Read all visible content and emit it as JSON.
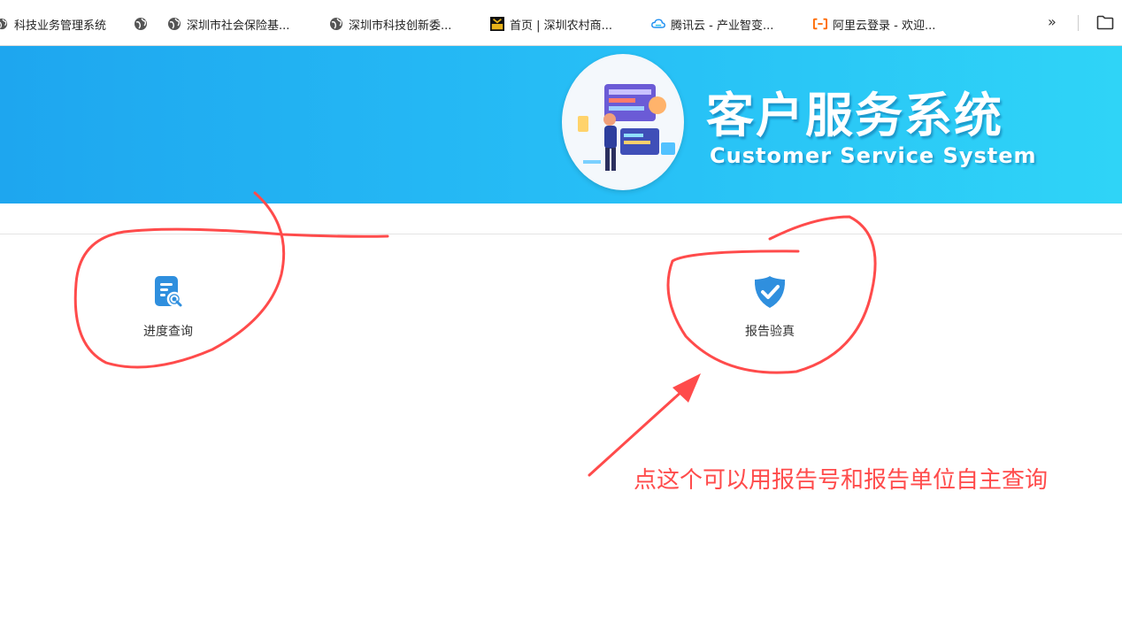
{
  "bookmarks": {
    "items": [
      {
        "label": "科技业务管理系统",
        "icon": "globe-icon"
      },
      {
        "label": "",
        "icon": "globe-icon"
      },
      {
        "label": "深圳市社会保险基...",
        "icon": "globe-icon"
      },
      {
        "label": "深圳市科技创新委...",
        "icon": "globe-icon"
      },
      {
        "label": "首页 | 深圳农村商...",
        "icon": "bank-logo-icon"
      },
      {
        "label": "腾讯云 - 产业智变...",
        "icon": "tencent-cloud-icon"
      },
      {
        "label": "阿里云登录 - 欢迎...",
        "icon": "aliyun-icon"
      }
    ],
    "overflow_label": "»",
    "folder_icon": "folder-icon"
  },
  "banner": {
    "title_cn": "客户服务系统",
    "title_en": "Customer Service System",
    "gradient": [
      "#1ea6ef",
      "#2fd4f7"
    ]
  },
  "tiles": [
    {
      "label": "进度查询",
      "icon": "document-search-icon",
      "color": "#2f8fde"
    },
    {
      "label": "报告验真",
      "icon": "shield-check-icon",
      "color": "#2f8fde"
    }
  ],
  "annotation": {
    "text": "点这个可以用报告号和报告单位自主查询",
    "color": "#ff4b4b"
  }
}
